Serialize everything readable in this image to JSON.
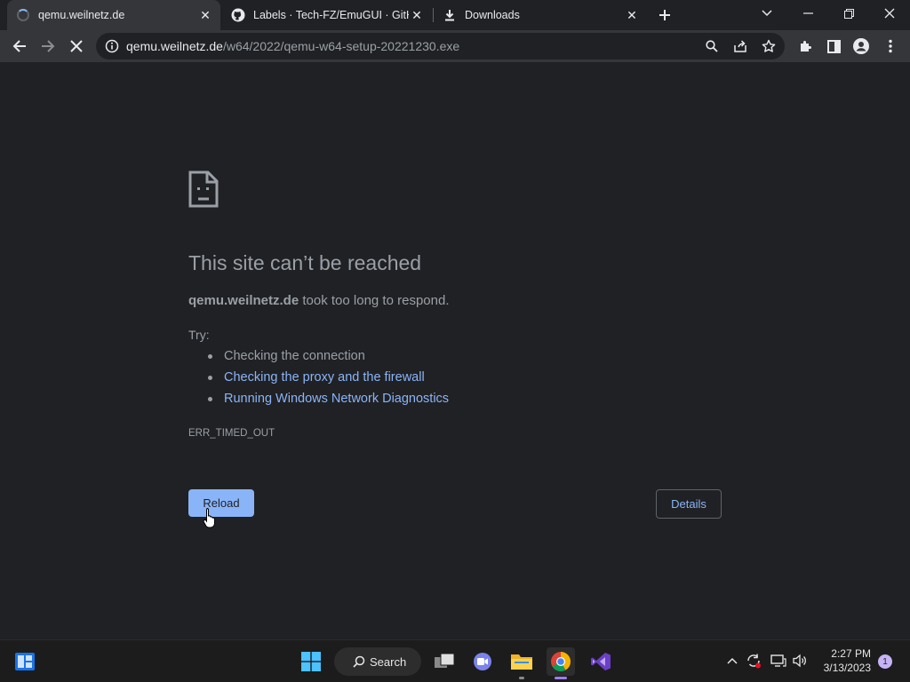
{
  "tabs": [
    {
      "title": "qemu.weilnetz.de",
      "active": true,
      "loading": true
    },
    {
      "title": "Labels · Tech-FZ/EmuGUI · GitHub",
      "active": false,
      "icon": "github-icon"
    },
    {
      "title": "Downloads",
      "active": false,
      "icon": "download-icon"
    }
  ],
  "toolbar": {
    "url_host": "qemu.weilnetz.de",
    "url_path": "/w64/2022/qemu-w64-setup-20221230.exe"
  },
  "error": {
    "title": "This site can’t be reached",
    "host": "qemu.weilnetz.de",
    "desc_suffix": " took too long to respond.",
    "try_label": "Try:",
    "suggestions": [
      {
        "text": "Checking the connection",
        "link": false
      },
      {
        "text": "Checking the proxy and the firewall",
        "link": true
      },
      {
        "text": "Running Windows Network Diagnostics",
        "link": true
      }
    ],
    "code": "ERR_TIMED_OUT",
    "reload_label": "Reload",
    "details_label": "Details"
  },
  "taskbar": {
    "search_label": "Search",
    "time": "2:27 PM",
    "date": "3/13/2023",
    "notification_count": "1"
  },
  "colors": {
    "accent": "#8ab4f8",
    "page_bg": "#202124",
    "toolbar_bg": "#35363a"
  }
}
